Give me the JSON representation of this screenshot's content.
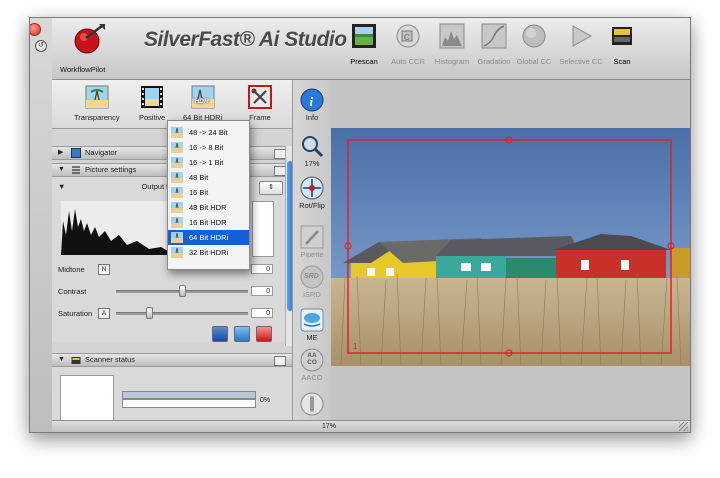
{
  "window": {
    "app_name": "SilverFast® Ai Studio",
    "logo_label": "WorkflowPilot"
  },
  "toolbar": {
    "items": [
      {
        "label": "Prescan",
        "state": "active"
      },
      {
        "label": "Auto CCR",
        "state": "disabled"
      },
      {
        "label": "Histogram",
        "state": "disabled"
      },
      {
        "label": "Gradation",
        "state": "disabled"
      },
      {
        "label": "Global CC",
        "state": "disabled"
      },
      {
        "label": "Selective CC",
        "state": "disabled"
      },
      {
        "label": "Scan",
        "state": "active"
      }
    ]
  },
  "tools": {
    "items": [
      {
        "label": "Transparency",
        "icon": "transparency-icon"
      },
      {
        "label": "Positive",
        "icon": "positive-film-icon"
      },
      {
        "label": "64 Bit HDRi",
        "icon": "hdr-icon",
        "badge": "HDR"
      },
      {
        "label": "Frame",
        "icon": "frame-tools-icon"
      }
    ]
  },
  "sections": {
    "navigator": "Navigator",
    "picture_settings": "Picture settings",
    "scanner_status": "Scanner status"
  },
  "picture": {
    "output_label": "Output f",
    "midtone_label": "Midtone",
    "midtone_mode": "N",
    "midtone_value": "0",
    "contrast_label": "Contrast",
    "contrast_value": "0",
    "contrast_level": 0.5,
    "saturation_label": "Saturation",
    "saturation_mode": "A",
    "saturation_value": "0",
    "saturation_level": 0.25
  },
  "dropdown": {
    "items": [
      {
        "label": "48 -> 24 Bit"
      },
      {
        "label": "16 -> 8 Bit"
      },
      {
        "label": "16 -> 1 Bit"
      },
      {
        "label": "48 Bit"
      },
      {
        "label": "16 Bit"
      },
      {
        "label": "48 Bit HDR"
      },
      {
        "label": "16 Bit HDR"
      },
      {
        "label": "64 Bit HDRi",
        "selected": true
      },
      {
        "label": "32 Bit HDRi"
      }
    ]
  },
  "vtools": {
    "items": [
      {
        "label": "Info",
        "icon": "info-icon",
        "state": "active"
      },
      {
        "label": "17%",
        "icon": "zoom-magnifier-icon",
        "state": "active"
      },
      {
        "label": "Rot/Flip",
        "icon": "rotate-flip-icon",
        "state": "active"
      },
      {
        "label": "Pipette",
        "icon": "pipette-icon",
        "state": "disabled"
      },
      {
        "label": "iSRD",
        "icon": "isrd-icon",
        "badge": "SRD",
        "state": "disabled"
      },
      {
        "label": "ME",
        "icon": "multi-exposure-icon",
        "state": "active"
      },
      {
        "label": "AACO",
        "icon": "aaco-icon",
        "badge": "AA CO",
        "state": "disabled"
      }
    ]
  },
  "scanner": {
    "progress_text": "0%",
    "progress": 0
  },
  "statusbar": {
    "zoom": "17%"
  },
  "preview": {
    "frame_number": "1"
  },
  "colors": {
    "accent_blue": "#1560d8",
    "frame_red": "#e0202a"
  }
}
